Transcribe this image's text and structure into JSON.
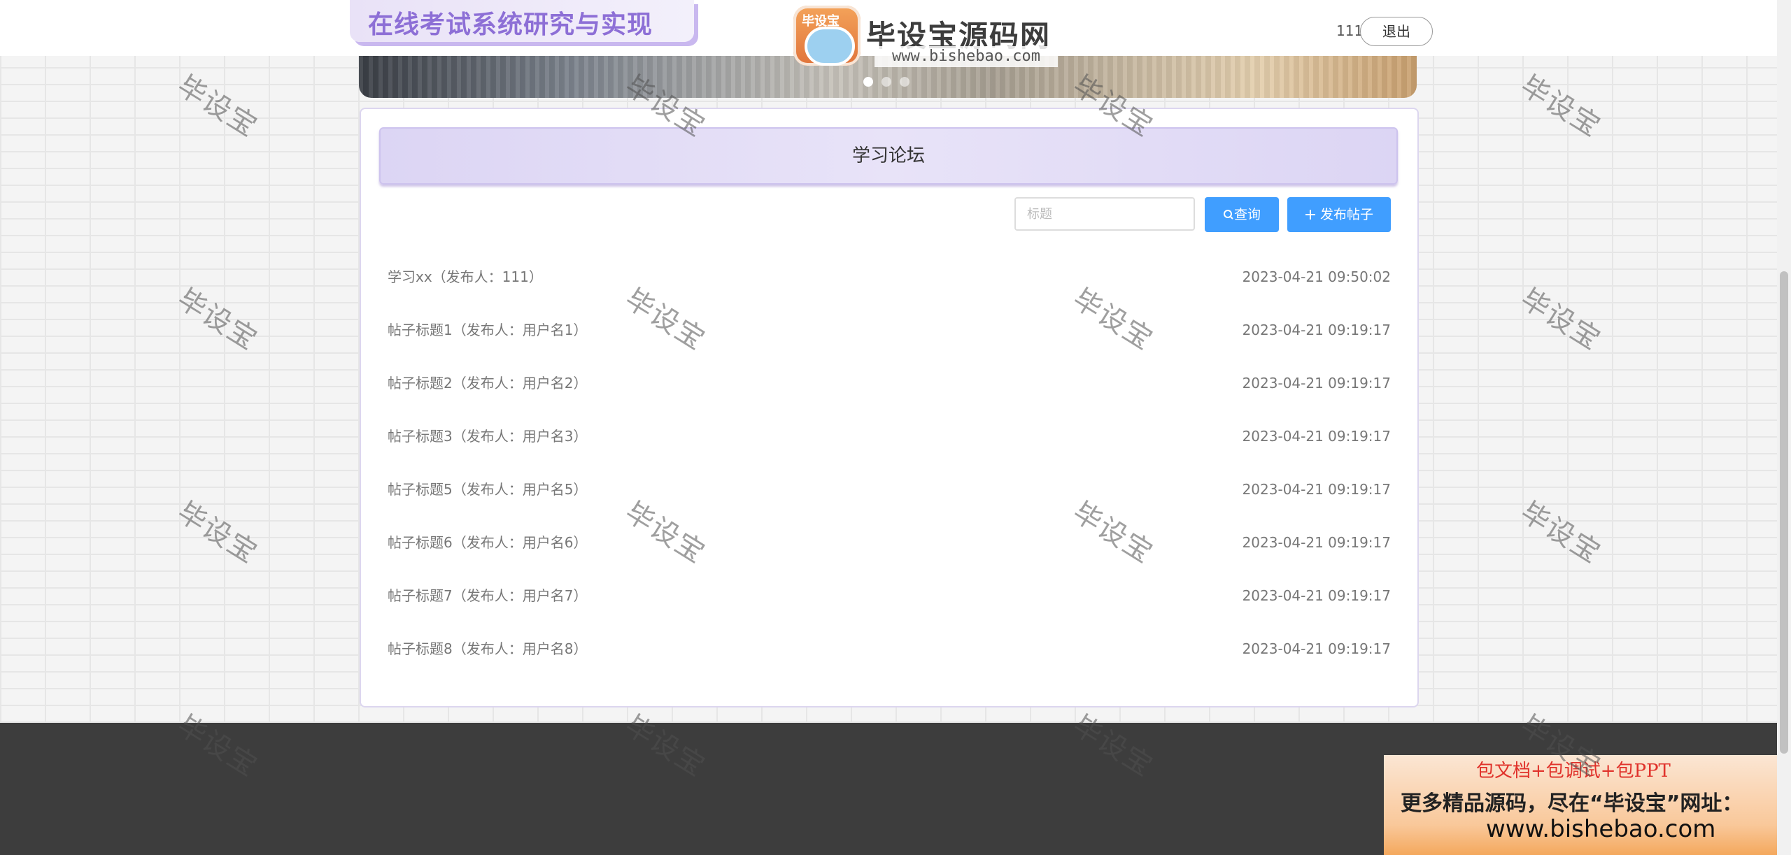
{
  "header": {
    "site_title": "在线考试系统研究与实现",
    "logo": {
      "badge_text": "毕设宝",
      "name": "毕设宝源码网",
      "url": "www.bishebao.com"
    },
    "user_name": "111",
    "logout_label": "退出"
  },
  "banner": {
    "slide_count": 3,
    "active_slide": 1
  },
  "forum": {
    "title": "学习论坛",
    "search_placeholder": "标题",
    "search_label": "查询",
    "post_label": "发布帖子",
    "posts": [
      {
        "title": "学习xx（发布人：111）",
        "time": "2023-04-21 09:50:02"
      },
      {
        "title": "帖子标题1（发布人：用户名1）",
        "time": "2023-04-21 09:19:17"
      },
      {
        "title": "帖子标题2（发布人：用户名2）",
        "time": "2023-04-21 09:19:17"
      },
      {
        "title": "帖子标题3（发布人：用户名3）",
        "time": "2023-04-21 09:19:17"
      },
      {
        "title": "帖子标题5（发布人：用户名5）",
        "time": "2023-04-21 09:19:17"
      },
      {
        "title": "帖子标题6（发布人：用户名6）",
        "time": "2023-04-21 09:19:17"
      },
      {
        "title": "帖子标题7（发布人：用户名7）",
        "time": "2023-04-21 09:19:17"
      },
      {
        "title": "帖子标题8（发布人：用户名8）",
        "time": "2023-04-21 09:19:17"
      }
    ]
  },
  "ad": {
    "line1": "包文档+包调试+包PPT",
    "line2": "更多精品源码，尽在“毕设宝”网址：",
    "line3": "www.bishebao.com"
  },
  "watermark_text": "毕设宝",
  "colors": {
    "primary": "#409eff",
    "accent": "#8d6fd6",
    "footer": "#3d3d3d"
  }
}
